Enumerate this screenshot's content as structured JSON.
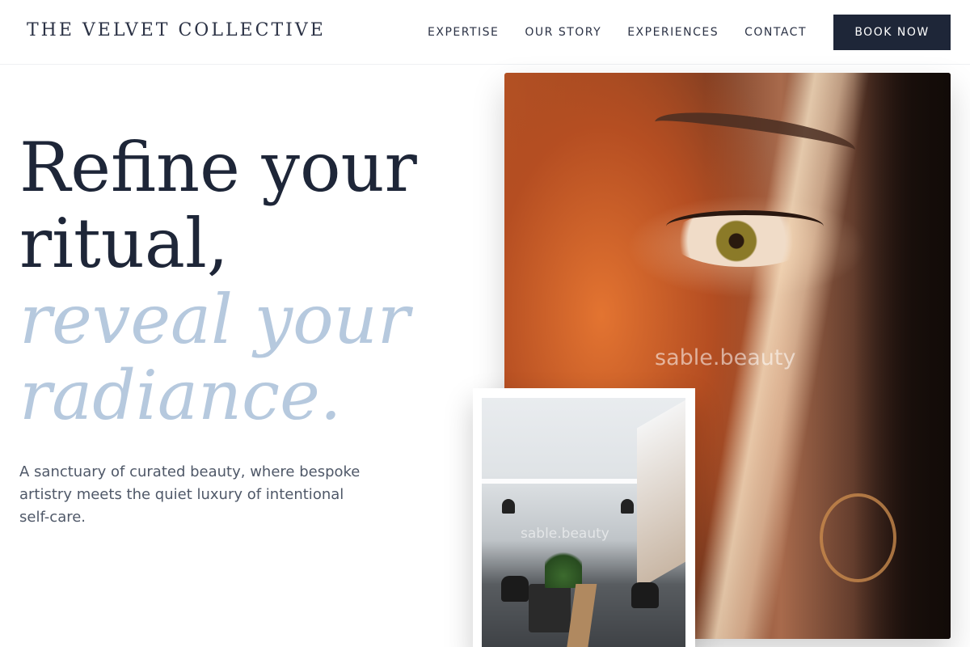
{
  "brand": {
    "name": "THE VELVET COLLECTIVE"
  },
  "nav": {
    "links": [
      "EXPERTISE",
      "OUR STORY",
      "EXPERIENCES",
      "CONTACT"
    ],
    "cta": "BOOK NOW"
  },
  "hero": {
    "title_line1": "Refine your",
    "title_line2": "ritual,",
    "title_line3": "reveal your",
    "title_line4": "radiance.",
    "subtitle": "A sanctuary of curated beauty, where bespoke artistry meets the quiet luxury of intentional self-care."
  },
  "images": {
    "main_watermark": "sable.beauty",
    "inset_watermark": "sable.beauty"
  },
  "colors": {
    "primary": "#1e2638",
    "accent_light": "#b6c9de",
    "body_text": "#4f5868"
  }
}
